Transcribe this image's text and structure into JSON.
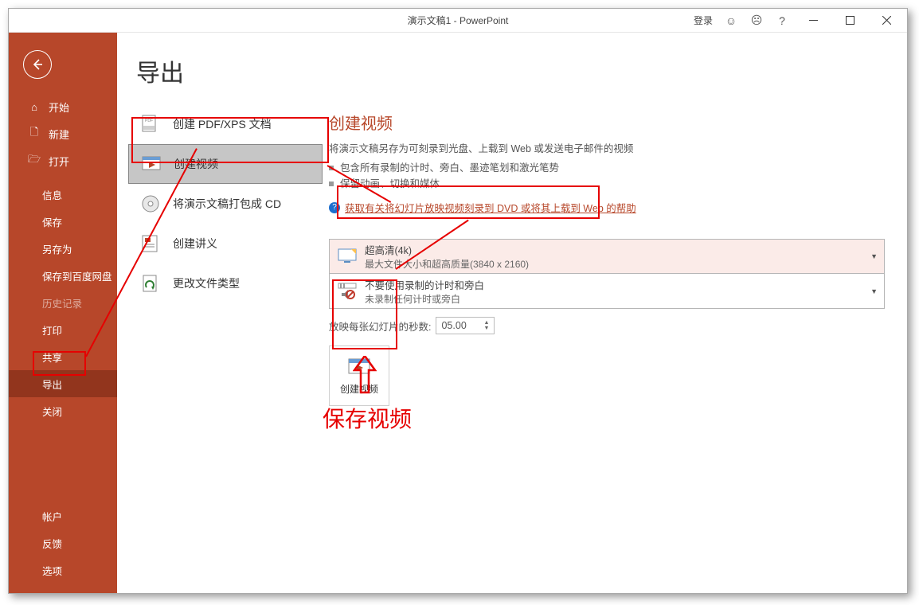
{
  "titlebar": {
    "title": "演示文稿1 - PowerPoint",
    "login": "登录"
  },
  "sidebar": {
    "home": "开始",
    "new": "新建",
    "open": "打开",
    "items": [
      {
        "label": "信息"
      },
      {
        "label": "保存"
      },
      {
        "label": "另存为"
      },
      {
        "label": "保存到百度网盘"
      },
      {
        "label": "历史记录"
      },
      {
        "label": "打印"
      },
      {
        "label": "共享"
      },
      {
        "label": "导出"
      },
      {
        "label": "关闭"
      }
    ],
    "bottom": [
      {
        "label": "帐户"
      },
      {
        "label": "反馈"
      },
      {
        "label": "选项"
      }
    ]
  },
  "main": {
    "page_title": "导出",
    "export_items": [
      {
        "label": "创建 PDF/XPS 文档"
      },
      {
        "label": "创建视频"
      },
      {
        "label": "将演示文稿打包成 CD"
      },
      {
        "label": "创建讲义"
      },
      {
        "label": "更改文件类型"
      }
    ]
  },
  "detail": {
    "heading": "创建视频",
    "desc": "将演示文稿另存为可刻录到光盘、上载到 Web 或发送电子邮件的视频",
    "bullet1": "包含所有录制的计时、旁白、墨迹笔划和激光笔势",
    "bullet2": "保留动画、切换和媒体",
    "help": "获取有关将幻灯片放映视频刻录到 DVD 或将其上载到 Web 的帮助",
    "quality": {
      "title": "超高清(4k)",
      "sub": "最大文件大小和超高质量(3840 x 2160)"
    },
    "timing": {
      "title": "不要使用录制的计时和旁白",
      "sub": "未录制任何计时或旁白"
    },
    "seconds_label": "放映每张幻灯片的秒数:",
    "seconds_value": "05.00",
    "create_button": "创建视频"
  },
  "annotation": {
    "save_video": "保存视频"
  }
}
